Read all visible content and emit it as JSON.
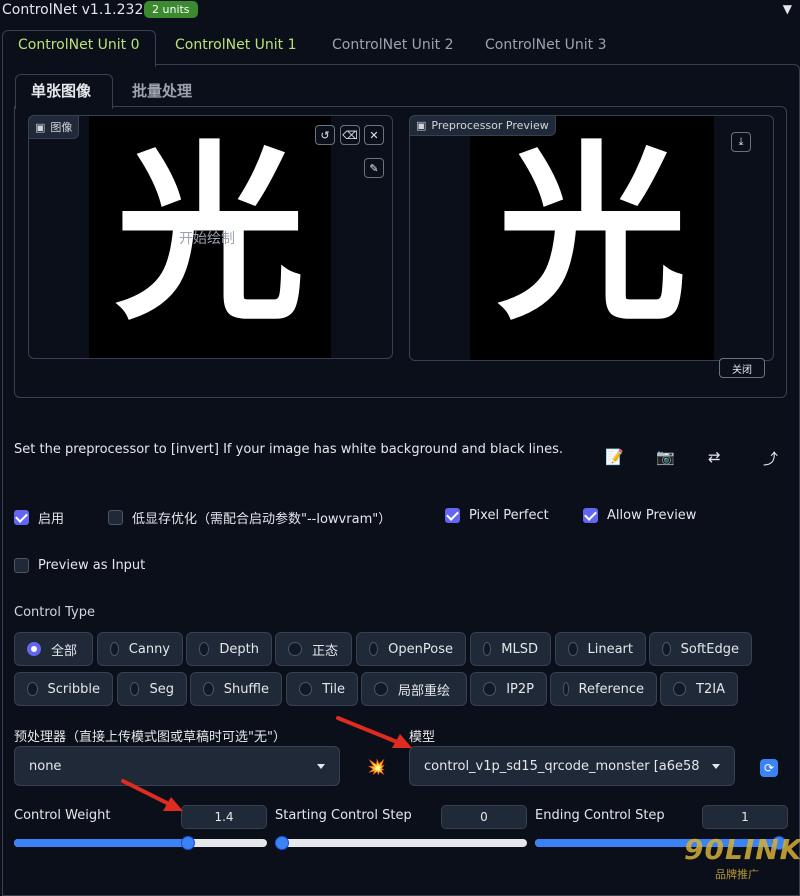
{
  "header": {
    "title": "ControlNet v1.1.232",
    "badge": "2 units",
    "collapse_icon": "triangle-down-icon"
  },
  "unit_tabs": [
    "ControlNet Unit 0",
    "ControlNet Unit 1",
    "ControlNet Unit 2",
    "ControlNet Unit 3"
  ],
  "sub_tabs": [
    "单张图像",
    "批量处理"
  ],
  "image_panel": {
    "label": "图像",
    "glyph": "光",
    "overlay": "开始绘制"
  },
  "preview_panel": {
    "label": "Preprocessor Preview",
    "glyph": "光",
    "close_label": "关闭"
  },
  "hint": "Set the preprocessor to [invert] If your image has white background and black lines.",
  "checkboxes": {
    "enable": "启用",
    "lowvram": "低显存优化（需配合启动参数\"--lowvram\"）",
    "pixel_perfect": "Pixel Perfect",
    "allow_preview": "Allow Preview",
    "preview_as_input": "Preview as Input"
  },
  "control_type": {
    "label": "Control Type",
    "row1": [
      "全部",
      "Canny",
      "Depth",
      "正态",
      "OpenPose",
      "MLSD",
      "Lineart",
      "SoftEdge"
    ],
    "row2": [
      "Scribble",
      "Seg",
      "Shuffle",
      "Tile",
      "局部重绘",
      "IP2P",
      "Reference",
      "T2IA"
    ],
    "selected": "全部"
  },
  "preprocessor": {
    "label": "预处理器（直接上传模式图或草稿时可选\"无\"）",
    "value": "none"
  },
  "model": {
    "label": "模型",
    "value": "control_v1p_sd15_qrcode_monster [a6e5899"
  },
  "sliders": {
    "weight": {
      "label": "Control Weight",
      "value": "1.4",
      "fraction": 0.7
    },
    "start": {
      "label": "Starting Control Step",
      "value": "0",
      "fraction": 0.0
    },
    "end": {
      "label": "Ending Control Step",
      "value": "1",
      "fraction": 1.0
    }
  },
  "watermark": {
    "brand": "90LINK",
    "sub": "品牌推广"
  },
  "colors": {
    "accent": "#6366f1",
    "slider": "#3b82f6",
    "active_tab": "#b9e27a",
    "badge": "#3b8a2f",
    "arrow": "#e02b20"
  }
}
